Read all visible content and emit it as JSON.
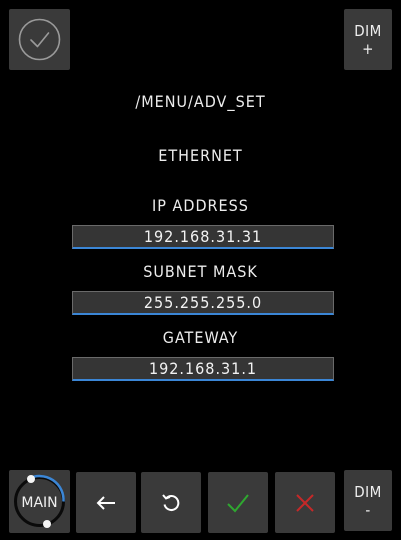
{
  "top": {
    "dim_plus": {
      "line1": "DIM",
      "line2": "+"
    }
  },
  "header": {
    "path": "/MENU/ADV_SET",
    "section": "ETHERNET"
  },
  "network": {
    "ip_label": "IP ADDRESS",
    "ip_value": "192.168.31.31",
    "subnet_label": "SUBNET MASK",
    "subnet_value": "255.255.255.0",
    "gateway_label": "GATEWAY",
    "gateway_value": "192.168.31.1"
  },
  "bottom": {
    "main_label": "MAIN",
    "dim_minus": {
      "line1": "DIM",
      "line2": "-"
    }
  },
  "icons": {
    "top_left": "check-circle-icon",
    "back": "arrow-left-icon",
    "refresh": "refresh-icon",
    "confirm": "check-icon",
    "cancel": "close-icon"
  },
  "colors": {
    "background": "#000000",
    "button": "#3a3a3a",
    "field": "#353535",
    "field_underline": "#3b86d6",
    "confirm": "#2fa830",
    "cancel": "#c62828"
  }
}
